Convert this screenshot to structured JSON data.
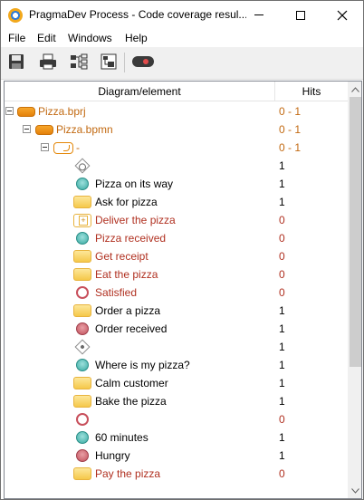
{
  "window": {
    "title": "PragmaDev Process - Code coverage resul..."
  },
  "menu": [
    "File",
    "Edit",
    "Windows",
    "Help"
  ],
  "toolbar": {
    "buttons": [
      "save-icon",
      "print-icon",
      "diagram-tree-icon",
      "export-icon",
      "record-icon"
    ]
  },
  "table": {
    "headers": {
      "diagram": "Diagram/element",
      "hits": "Hits"
    },
    "rows": [
      {
        "label": "Pizza.bprj",
        "hits": "0 - 1",
        "icon": "project-icon",
        "expander": true,
        "color": "orange"
      },
      {
        "label": "Pizza.bpmn",
        "hits": "0 - 1",
        "icon": "project-icon",
        "expander": true,
        "color": "orange"
      },
      {
        "label": "-",
        "hits": "0 - 1",
        "icon": "pool-icon",
        "expander": true,
        "color": "orange"
      },
      {
        "label": "",
        "hits": "1",
        "icon": "gateway-ring-icon",
        "color": ""
      },
      {
        "label": "Pizza on its way",
        "hits": "1",
        "icon": "message-event-icon",
        "color": ""
      },
      {
        "label": "Ask for pizza",
        "hits": "1",
        "icon": "task-icon",
        "color": ""
      },
      {
        "label": "Deliver the pizza",
        "hits": "0",
        "icon": "subprocess-icon",
        "color": "red"
      },
      {
        "label": "Pizza received",
        "hits": "0",
        "icon": "message-event-icon",
        "color": "red"
      },
      {
        "label": "Get receipt",
        "hits": "0",
        "icon": "task-icon",
        "color": "red"
      },
      {
        "label": "Eat the pizza",
        "hits": "0",
        "icon": "task-icon",
        "color": "red"
      },
      {
        "label": "Satisfied",
        "hits": "0",
        "icon": "end-event-empty-icon",
        "color": "red"
      },
      {
        "label": "Order a pizza",
        "hits": "1",
        "icon": "task-icon",
        "color": ""
      },
      {
        "label": "Order received",
        "hits": "1",
        "icon": "end-event-icon",
        "color": ""
      },
      {
        "label": "",
        "hits": "1",
        "icon": "gateway-plus-icon",
        "color": ""
      },
      {
        "label": "Where is my pizza?",
        "hits": "1",
        "icon": "message-event-icon",
        "color": ""
      },
      {
        "label": "Calm customer",
        "hits": "1",
        "icon": "task-icon",
        "color": ""
      },
      {
        "label": "Bake the pizza",
        "hits": "1",
        "icon": "task-icon",
        "color": ""
      },
      {
        "label": "",
        "hits": "0",
        "icon": "end-event-empty-icon",
        "color": "red"
      },
      {
        "label": "60 minutes",
        "hits": "1",
        "icon": "message-event-icon",
        "color": ""
      },
      {
        "label": "Hungry",
        "hits": "1",
        "icon": "end-event-icon",
        "color": ""
      },
      {
        "label": "Pay the pizza",
        "hits": "0",
        "icon": "task-icon",
        "color": "red"
      }
    ]
  },
  "colors": {
    "uncovered": "#b03020",
    "partial": "#c26a12"
  }
}
